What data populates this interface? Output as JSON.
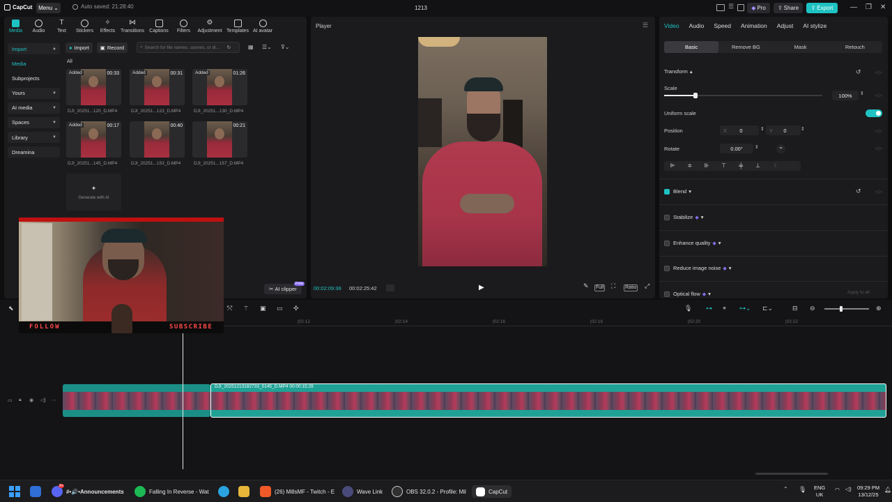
{
  "titlebar": {
    "logo": "CapCut",
    "menu_label": "Menu",
    "autosave": "Auto saved: 21:28:40",
    "project_title": "1213",
    "pro_label": "Pro",
    "share_label": "Share",
    "export_label": "Export"
  },
  "left_panel": {
    "categories": [
      "Media",
      "Audio",
      "Text",
      "Stickers",
      "Effects",
      "Transitions",
      "Captions",
      "Filters",
      "Adjustment",
      "Templates",
      "AI avatar"
    ],
    "active_category": "Media",
    "side_nav": [
      "Import",
      "Media",
      "Subprojects",
      "Yours",
      "AI media",
      "Spaces",
      "Library",
      "Dreamina"
    ],
    "import_label": "Import",
    "record_label": "Record",
    "search_placeholder": "Search for file names, scenes, or di...",
    "all_label": "All",
    "clips": [
      {
        "added": "Added",
        "duration": "00:33",
        "name": "DJI_20251...120_D.MP4"
      },
      {
        "added": "Added",
        "duration": "00:31",
        "name": "DJI_20251...123_D.MP4"
      },
      {
        "added": "Added",
        "duration": "01:26",
        "name": "DJI_20251...130_D.MP4"
      },
      {
        "added": "Added",
        "duration": "00:17",
        "name": "DJI_20251...145_D.MP4"
      },
      {
        "added": "",
        "duration": "00:40",
        "name": "DJI_20251...153_D.MP4"
      },
      {
        "added": "",
        "duration": "00:21",
        "name": "DJI_20251...157_D.MP4"
      }
    ],
    "generate_ai": "Generate with AI",
    "ai_clipper": "AI clipper",
    "free_badge": "Free"
  },
  "webcam": {
    "follow": "FOLLOW",
    "subscribe": "SUBSCRIBE"
  },
  "player": {
    "title": "Player",
    "current_time": "00:02:09:38",
    "duration": "00:02:25:42",
    "full_label": "Full",
    "ratio_label": "Ratio"
  },
  "right_panel": {
    "tabs": [
      "Video",
      "Audio",
      "Speed",
      "Animation",
      "Adjust",
      "AI stylize"
    ],
    "subtabs": [
      "Basic",
      "Remove BG",
      "Mask",
      "Retouch"
    ],
    "transform": "Transform",
    "scale_label": "Scale",
    "scale_value": "100%",
    "scale_fraction": 0.2,
    "uniform_scale": "Uniform scale",
    "position_label": "Position",
    "pos_x_label": "X",
    "pos_x": "0",
    "pos_y_label": "Y",
    "pos_y": "0",
    "rotate_label": "Rotate",
    "rotate_value": "0.00°",
    "blend": "Blend",
    "stabilize": "Stabilize",
    "enhance_quality": "Enhance quality",
    "reduce_noise": "Reduce image noise",
    "optical_flow": "Optical flow",
    "apply_all": "Apply to all"
  },
  "timeline": {
    "ticks": [
      "|02:12",
      "|02:14",
      "|02:16",
      "|02:18",
      "|02:20",
      "|02:22"
    ],
    "clip_b_label": "DJI_20251213182733_0145_D.MP4   00:00:15:29"
  },
  "taskbar": {
    "items": [
      {
        "label": "#•🔊•Announcements",
        "badge": "9+"
      },
      {
        "label": "Falling In Reverse - Wat"
      },
      {
        "label": "(26) MillsMF - Twitch - E"
      },
      {
        "label": "Wave Link"
      },
      {
        "label": "OBS 32.0.2 - Profile: Mil"
      },
      {
        "label": "CapCut"
      }
    ],
    "lang_top": "ENG",
    "lang_bottom": "UK",
    "time": "09:29 PM",
    "date": "13/12/25"
  }
}
